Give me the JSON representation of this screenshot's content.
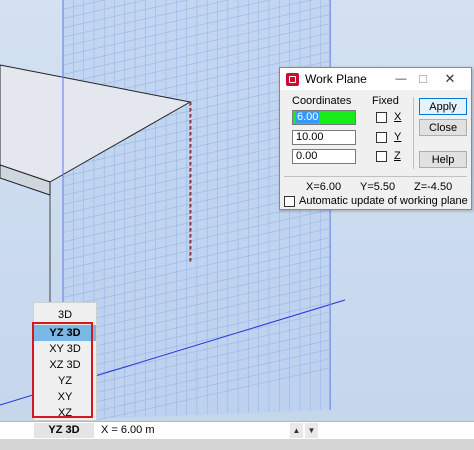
{
  "dialog": {
    "title": "Work Plane",
    "coordinates_label": "Coordinates",
    "fixed_label": "Fixed",
    "coord_values": [
      "6.00",
      "10.00",
      "0.00"
    ],
    "axis_labels": [
      "X",
      "Y",
      "Z"
    ],
    "buttons": {
      "apply": "Apply",
      "close": "Close",
      "help": "Help"
    },
    "status": {
      "x": "X=6.00",
      "y": "Y=5.50",
      "z": "Z=-4.50"
    },
    "auto_update_label": "Automatic update of working plane",
    "minimize_glyph": "—",
    "maximize_glyph": "☐",
    "close_glyph": "✕"
  },
  "plane_menu": {
    "items": [
      "3D",
      "YZ 3D",
      "XY 3D",
      "XZ 3D",
      "YZ",
      "XY",
      "XZ"
    ],
    "active_index": 1
  },
  "statusbar": {
    "plane": "YZ 3D",
    "x_value": "X = 6.00 m",
    "spin_up_glyph": "▲",
    "spin_down_glyph": "▼"
  },
  "colors": {
    "accent": "#0078d7",
    "selection_highlight": "#18ec18",
    "menu_active": "#79b7e6",
    "callout_box": "#d9161e",
    "app_icon": "#c8102e"
  }
}
